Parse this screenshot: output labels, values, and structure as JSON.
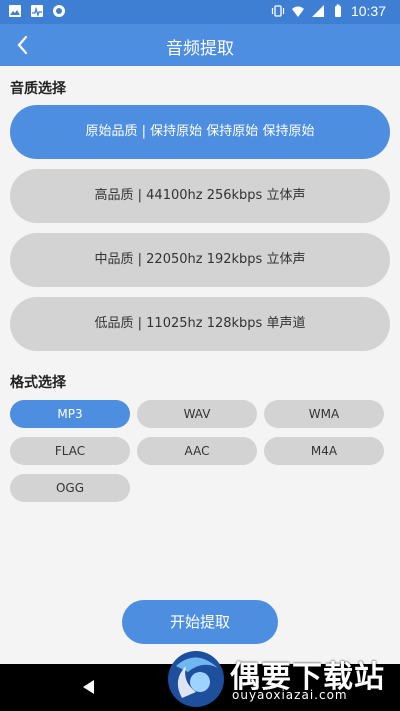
{
  "status_bar": {
    "time": "10:37",
    "left_icons": [
      "image-icon",
      "activity-icon",
      "circle-icon"
    ],
    "right_icons": [
      "vibrate-icon",
      "wifi-icon",
      "signal-icon",
      "battery-icon"
    ]
  },
  "app_bar": {
    "title": "音频提取",
    "back_icon": "chevron-left-icon"
  },
  "quality_section": {
    "title": "音质选择",
    "options": [
      {
        "label": "原始品质 | 保持原始 保持原始 保持原始",
        "selected": true
      },
      {
        "label": "高品质 | 44100hz 256kbps 立体声",
        "selected": false
      },
      {
        "label": "中品质 | 22050hz 192kbps 立体声",
        "selected": false
      },
      {
        "label": "低品质 | 11025hz 128kbps 单声道",
        "selected": false
      }
    ]
  },
  "format_section": {
    "title": "格式选择",
    "options": [
      {
        "label": "MP3",
        "selected": true
      },
      {
        "label": "WAV",
        "selected": false
      },
      {
        "label": "WMA",
        "selected": false
      },
      {
        "label": "FLAC",
        "selected": false
      },
      {
        "label": "AAC",
        "selected": false
      },
      {
        "label": "M4A",
        "selected": false
      },
      {
        "label": "OGG",
        "selected": false
      }
    ]
  },
  "start_button": {
    "label": "开始提取"
  },
  "watermark": {
    "title": "偶要下载站",
    "url": "ouyaoxiazai.com"
  },
  "colors": {
    "accent": "#4d8ee0",
    "status_bar": "#3f7fd3",
    "unselected": "#d3d3d3",
    "background": "#f4f4f4"
  }
}
